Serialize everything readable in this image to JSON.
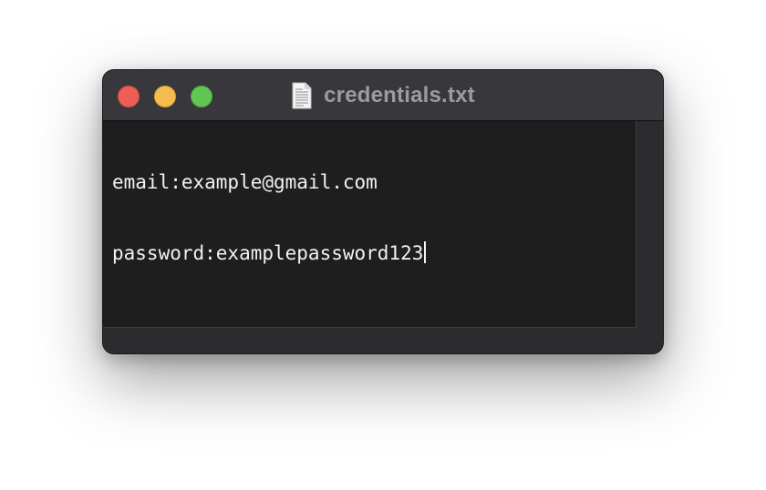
{
  "window": {
    "title": "credentials.txt",
    "title_icon": "text-document-icon"
  },
  "traffic_lights": {
    "close_color": "#ec5f57",
    "minimize_color": "#f4bd4f",
    "zoom_color": "#62c654"
  },
  "editor": {
    "lines": [
      "email:example@gmail.com",
      "password:examplepassword123"
    ]
  }
}
